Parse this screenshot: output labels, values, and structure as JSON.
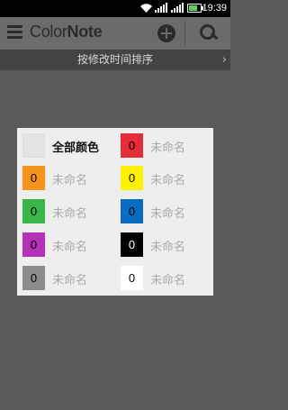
{
  "status_bar": {
    "time": "19:39"
  },
  "app_bar": {
    "logo_light": "Color",
    "logo_dark": "Note"
  },
  "sort_bar": {
    "label": "按修改时间排序",
    "chevron": "›"
  },
  "dialog": {
    "all": {
      "label": "全部颜色"
    },
    "colors": [
      {
        "count": "0",
        "label": "未命名",
        "color": "#e52d3a"
      },
      {
        "count": "0",
        "label": "未命名",
        "color": "#f7941d"
      },
      {
        "count": "0",
        "label": "未命名",
        "color": "#fff200"
      },
      {
        "count": "0",
        "label": "未命名",
        "color": "#39b54a"
      },
      {
        "count": "0",
        "label": "未命名",
        "color": "#0a6bc3"
      },
      {
        "count": "0",
        "label": "未命名",
        "color": "#b630b8"
      },
      {
        "count": "0",
        "label": "未命名",
        "color": "#000000"
      },
      {
        "count": "0",
        "label": "未命名",
        "color": "#8c8c8c"
      },
      {
        "count": "0",
        "label": "未命名",
        "color": "#ffffff"
      }
    ]
  }
}
